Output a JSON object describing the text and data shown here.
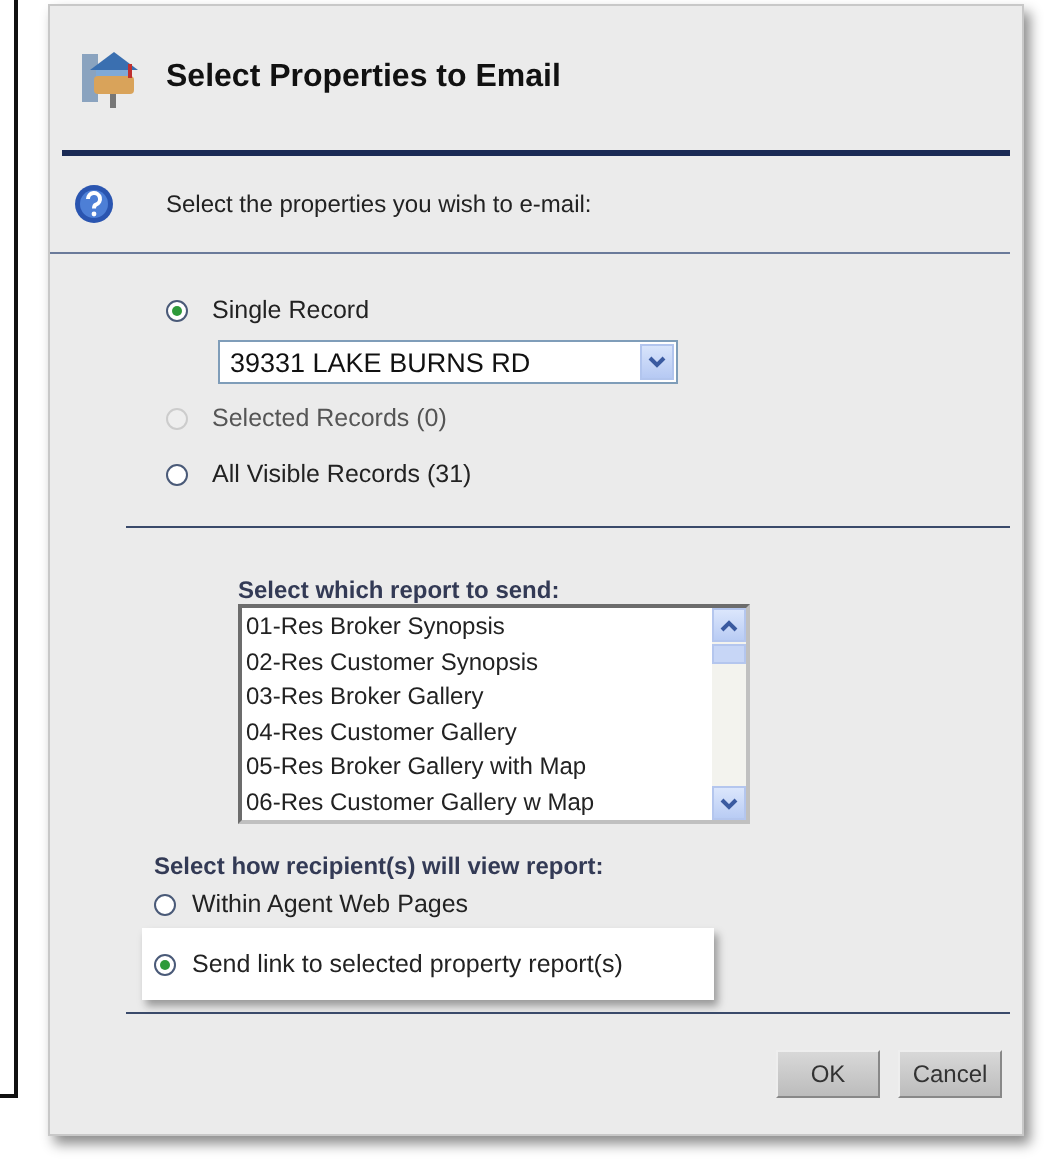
{
  "dialog": {
    "title": "Select Properties to Email",
    "prompt": "Select the properties you wish to e-mail:",
    "scope_options": [
      {
        "label": "Single Record",
        "selected": true,
        "disabled": false
      },
      {
        "label": "Selected Records (0)",
        "selected": false,
        "disabled": true
      },
      {
        "label": "All Visible Records (31)",
        "selected": false,
        "disabled": false
      }
    ],
    "record_select": {
      "value": "39331 LAKE BURNS RD"
    },
    "report_label": "Select which report to send:",
    "reports": [
      {
        "label": "01-Res Broker Synopsis",
        "selected": false
      },
      {
        "label": "02-Res Customer Synopsis",
        "selected": false
      },
      {
        "label": "03-Res Broker Gallery",
        "selected": false
      },
      {
        "label": "04-Res Customer Gallery",
        "selected": false
      },
      {
        "label": "05-Res Broker Gallery with Map",
        "selected": false
      },
      {
        "label": "06-Res Customer Gallery w Map",
        "selected": false
      }
    ],
    "view_label": "Select how recipient(s) will view report:",
    "view_options": [
      {
        "label": "Within Agent Web Pages",
        "selected": false,
        "highlighted": false
      },
      {
        "label": "Send link to selected property report(s)",
        "selected": true,
        "highlighted": true
      }
    ],
    "buttons": [
      "OK",
      "Cancel"
    ]
  }
}
